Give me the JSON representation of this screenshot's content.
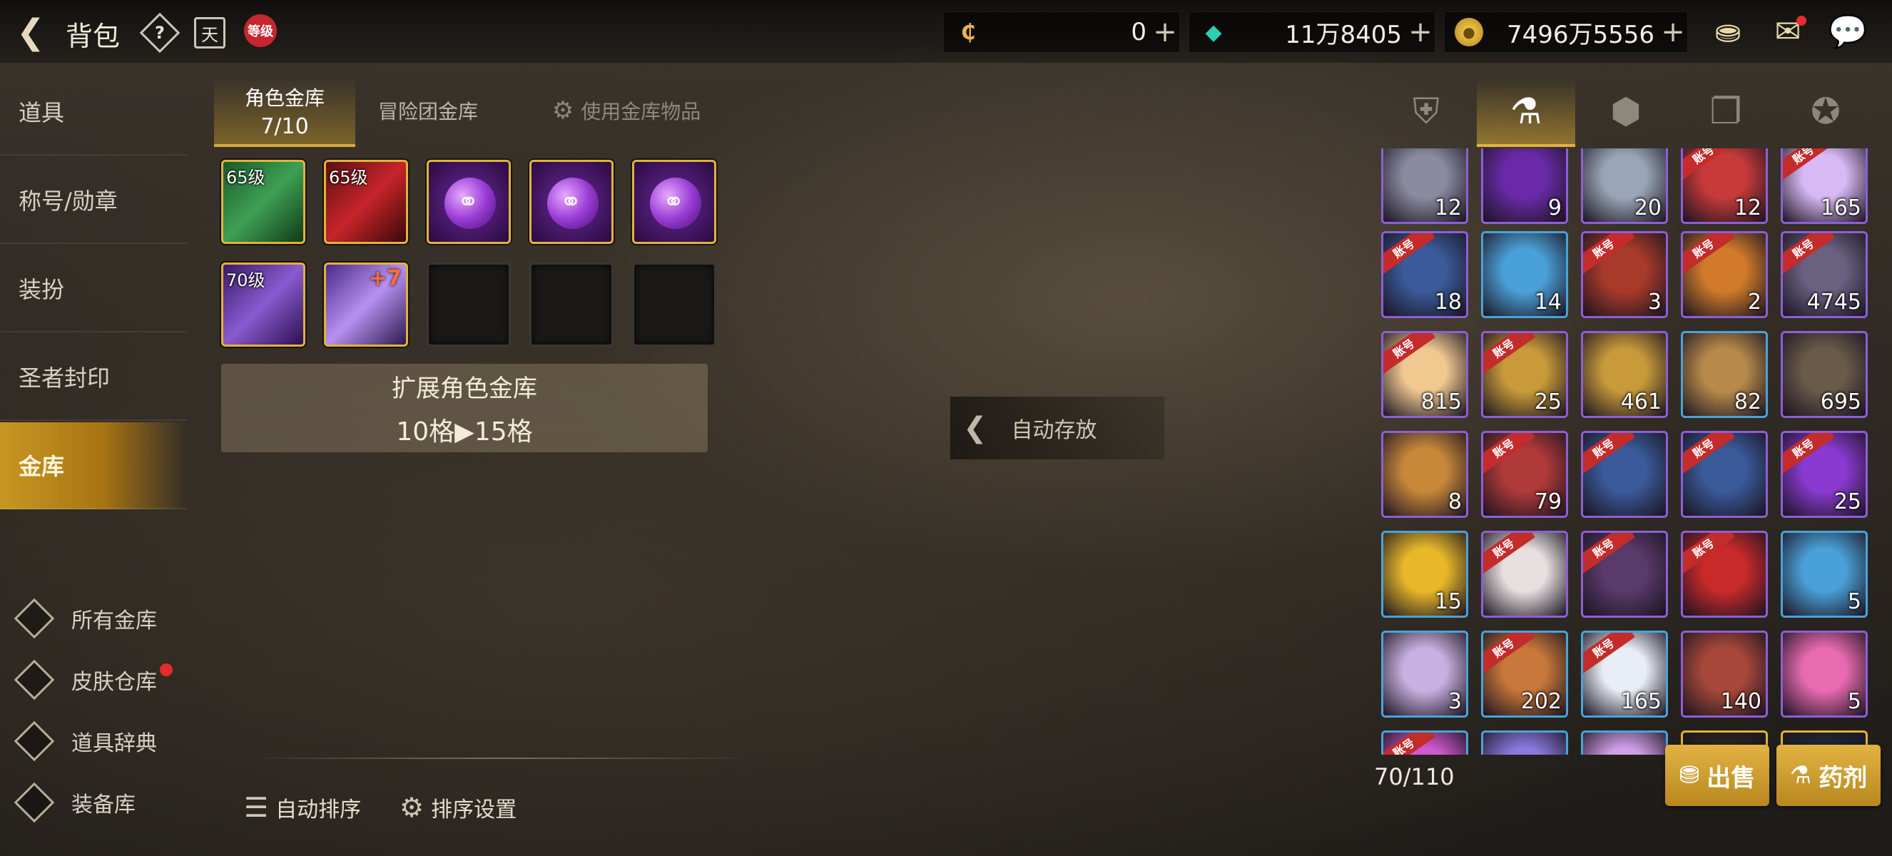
{
  "header": {
    "title": "背包",
    "level_badge": "等级",
    "cal_char": "天",
    "currencies": [
      {
        "name": "c-coin",
        "value": "0"
      },
      {
        "name": "crystal",
        "value": "11万8405"
      },
      {
        "name": "gold",
        "value": "7496万5556"
      }
    ]
  },
  "sidebar": {
    "items": [
      {
        "label": "道具"
      },
      {
        "label": "称号/勋章"
      },
      {
        "label": "装扮"
      },
      {
        "label": "圣者封印"
      },
      {
        "label": "金库"
      }
    ],
    "bottom": [
      {
        "label": "所有金库"
      },
      {
        "label": "皮肤仓库"
      },
      {
        "label": "道具辞典"
      },
      {
        "label": "装备库"
      }
    ]
  },
  "vault": {
    "tabs": [
      {
        "label": "角色金库",
        "sub": "7/10"
      },
      {
        "label": "冒险团金库"
      },
      {
        "label": "使用金库物品"
      }
    ],
    "slots": [
      {
        "level": "65级",
        "kind": "green"
      },
      {
        "level": "65级",
        "kind": "red"
      },
      {
        "level": "",
        "kind": "orb"
      },
      {
        "level": "",
        "kind": "orb"
      },
      {
        "level": "",
        "kind": "orb"
      },
      {
        "level": "70级",
        "kind": "purple"
      },
      {
        "level": "",
        "kind": "blade",
        "enhance": "+7"
      },
      {
        "level": "",
        "kind": "empty"
      },
      {
        "level": "",
        "kind": "empty"
      },
      {
        "level": "",
        "kind": "empty"
      }
    ],
    "expand_title": "扩展角色金库",
    "expand_sub": "10格▶15格",
    "auto_store": "自动存放",
    "auto_sort": "自动排序",
    "sort_settings": "排序设置"
  },
  "inventory": {
    "capacity": "70/110",
    "sell": "出售",
    "potion": "药剂",
    "account_tag": "账号",
    "rows": [
      [
        {
          "c": "12",
          "b": "purple",
          "col": "#8a8aa0"
        },
        {
          "c": "9",
          "b": "purple",
          "col": "#6a2aa8"
        },
        {
          "c": "20",
          "b": "purple",
          "col": "#9aa6b8"
        },
        {
          "c": "12",
          "b": "purple",
          "col": "#c83a3a",
          "acct": true
        },
        {
          "c": "165",
          "b": "purple",
          "col": "#d9b9f5",
          "acct": true
        }
      ],
      [
        {
          "c": "18",
          "b": "purple",
          "col": "#3a5a9a",
          "acct": true
        },
        {
          "c": "14",
          "b": "blue",
          "col": "#4aa0d8"
        },
        {
          "c": "3",
          "b": "purple",
          "col": "#a83a2a",
          "acct": true
        },
        {
          "c": "2",
          "b": "purple",
          "col": "#d07a2a",
          "acct": true
        },
        {
          "c": "4745",
          "b": "purple",
          "col": "#6a6080",
          "acct": true
        }
      ],
      [
        {
          "c": "815",
          "b": "purple",
          "col": "#f0c890",
          "acct": true
        },
        {
          "c": "25",
          "b": "purple",
          "col": "#c89a3a",
          "acct": true
        },
        {
          "c": "461",
          "b": "purple",
          "col": "#c89a3a"
        },
        {
          "c": "82",
          "b": "blue",
          "col": "#b88a4a"
        },
        {
          "c": "695",
          "b": "purple",
          "col": "#6a5a4a"
        }
      ],
      [
        {
          "c": "8",
          "b": "purple",
          "col": "#c8883a"
        },
        {
          "c": "79",
          "b": "purple",
          "col": "#b03a3a",
          "acct": true
        },
        {
          "c": "",
          "b": "purple",
          "col": "#3a5a9a",
          "acct": true
        },
        {
          "c": "",
          "b": "purple",
          "col": "#3a5a9a",
          "acct": true
        },
        {
          "c": "25",
          "b": "purple",
          "col": "#8a3ad0",
          "acct": true
        }
      ],
      [
        {
          "c": "15",
          "b": "blue",
          "col": "#e8b82a"
        },
        {
          "c": "",
          "b": "purple",
          "col": "#e8e0e0",
          "acct": true
        },
        {
          "c": "",
          "b": "purple",
          "col": "#5a3a6a",
          "acct": true
        },
        {
          "c": "",
          "b": "purple",
          "col": "#c82a2a",
          "acct": true
        },
        {
          "c": "5",
          "b": "blue",
          "col": "#4aa0d8"
        }
      ],
      [
        {
          "c": "3",
          "b": "blue",
          "col": "#c8b0e0"
        },
        {
          "c": "202",
          "b": "blue",
          "col": "#c8783a",
          "acct": true
        },
        {
          "c": "165",
          "b": "blue",
          "col": "#e8eef5",
          "acct": true
        },
        {
          "c": "140",
          "b": "purple",
          "col": "#a8483a"
        },
        {
          "c": "5",
          "b": "purple",
          "col": "#e86ab0"
        }
      ],
      [
        {
          "c": "",
          "b": "blue",
          "col": "#d05ad0",
          "acct": true
        },
        {
          "c": "",
          "b": "blue",
          "col": "#8a7ae0"
        },
        {
          "c": "",
          "b": "blue",
          "col": "#d0a0e8"
        },
        {
          "c": "",
          "b": "gold",
          "col": "#2a2620"
        },
        {
          "c": "",
          "b": "gold",
          "col": "#1e2a34"
        }
      ]
    ]
  }
}
